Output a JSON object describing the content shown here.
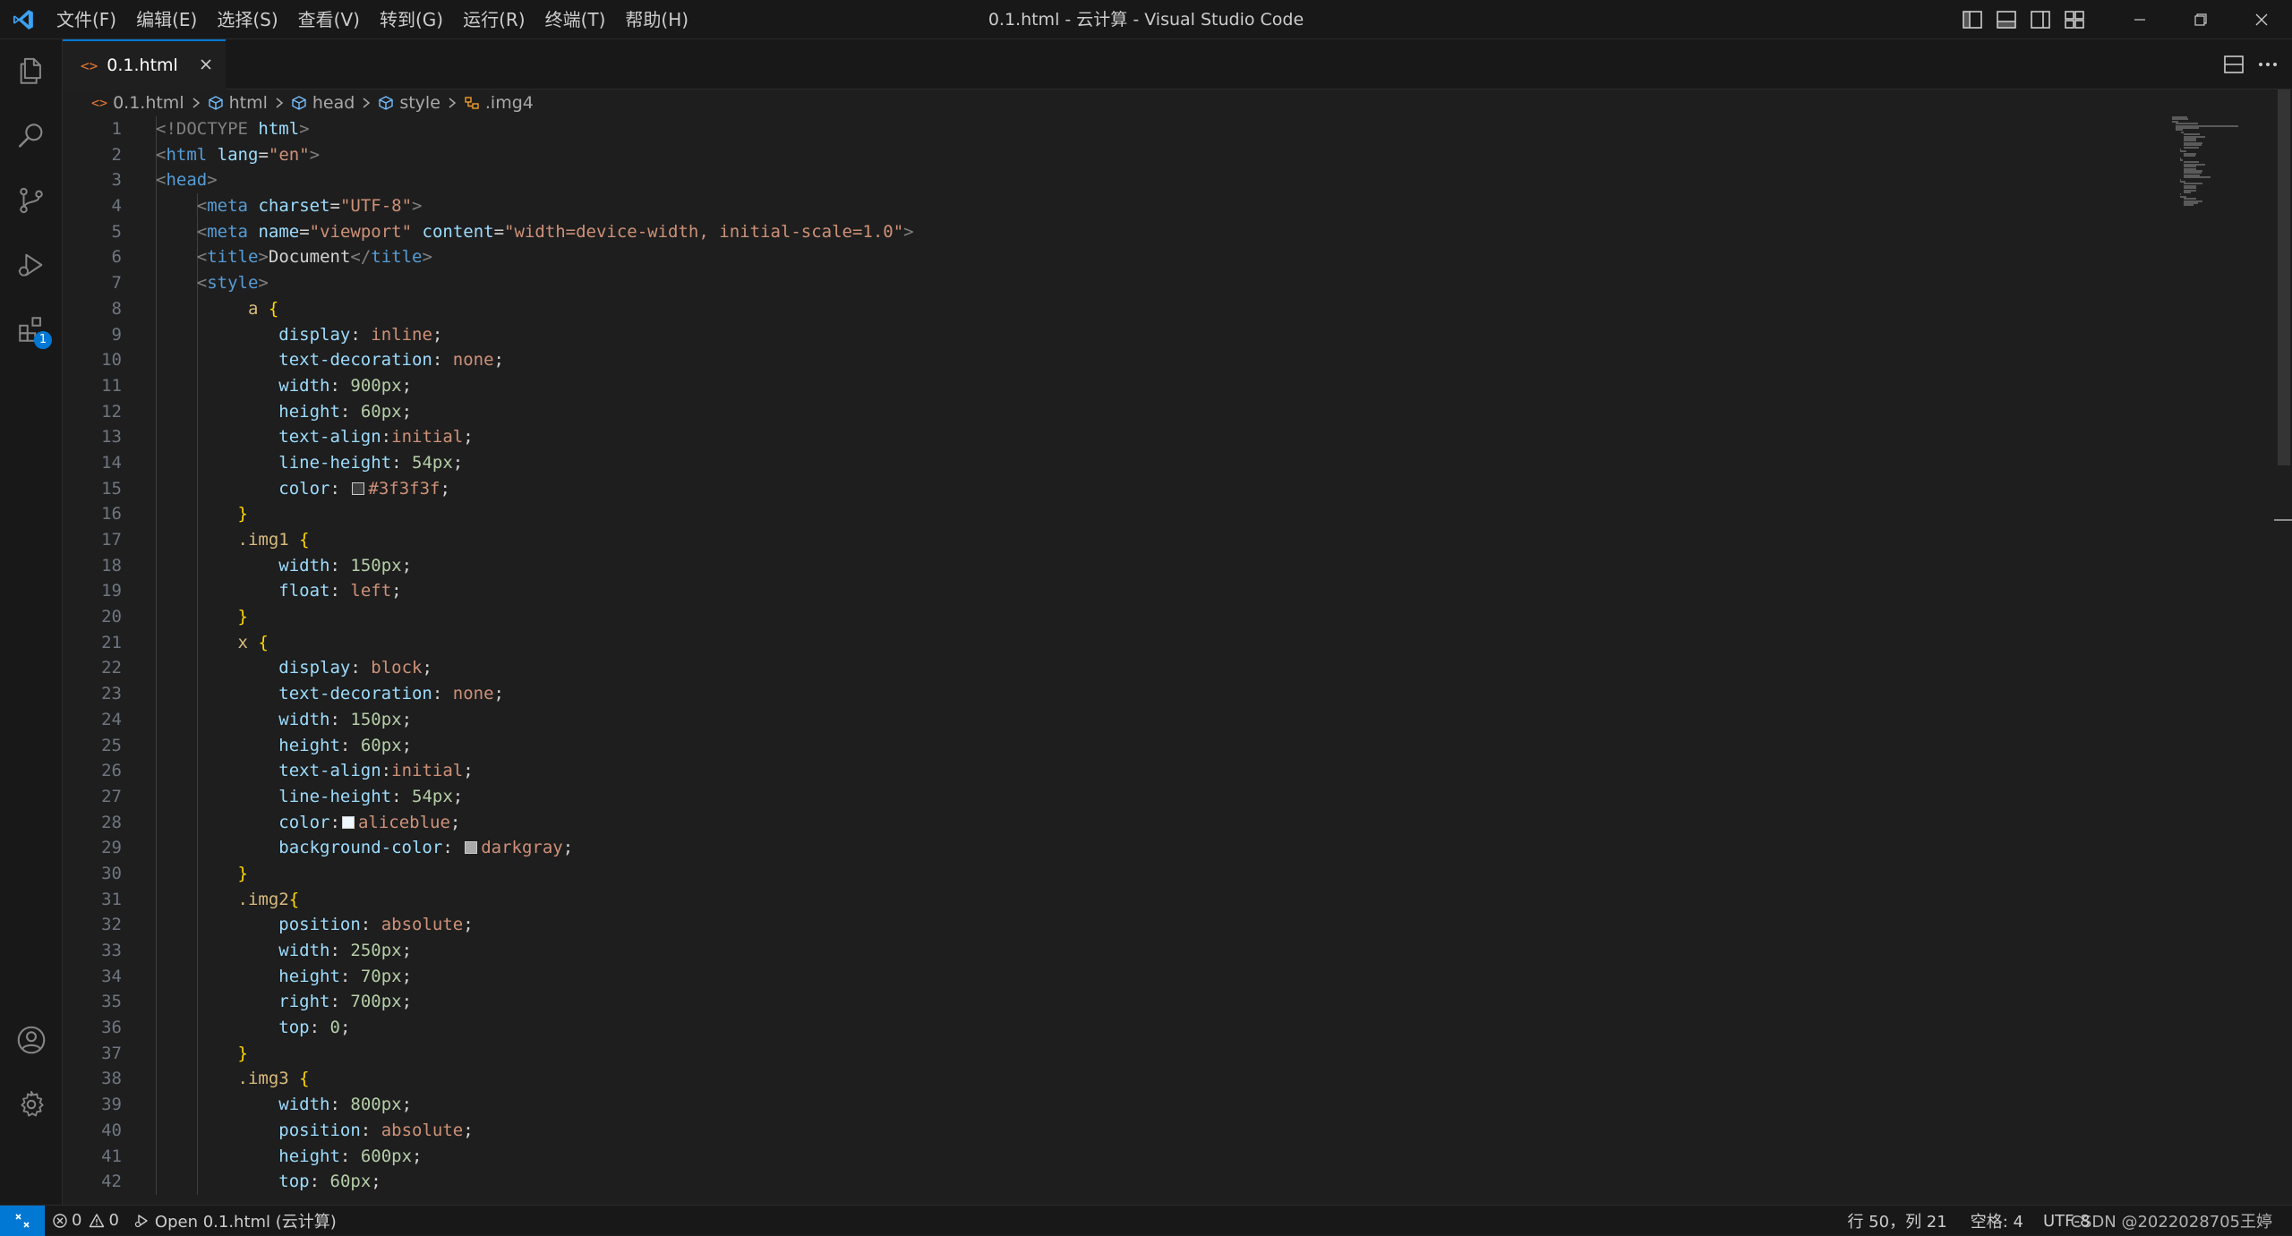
{
  "titlebar": {
    "menu": [
      "文件(F)",
      "编辑(E)",
      "选择(S)",
      "查看(V)",
      "转到(G)",
      "运行(R)",
      "终端(T)",
      "帮助(H)"
    ],
    "window_title": "0.1.html - 云计算 - Visual Studio Code"
  },
  "activitybar": {
    "extensions_badge": "1",
    "items": [
      "files-icon",
      "search-icon",
      "source-control-icon",
      "run-debug-icon",
      "extensions-icon",
      "account-icon",
      "gear-icon"
    ]
  },
  "tab": {
    "icon": "<>",
    "label": "0.1.html"
  },
  "breadcrumb": {
    "file": "0.1.html",
    "items": [
      "html",
      "head",
      "style",
      ".img4"
    ]
  },
  "editor": {
    "line_numbers": [
      "1",
      "2",
      "3",
      "4",
      "5",
      "6",
      "7",
      "8",
      "9",
      "10",
      "11",
      "12",
      "13",
      "14",
      "15",
      "16",
      "17",
      "18",
      "19",
      "20",
      "21",
      "22",
      "23",
      "24",
      "25",
      "26",
      "27",
      "28",
      "29",
      "30",
      "31",
      "32",
      "33",
      "34",
      "35",
      "36",
      "37",
      "38",
      "39",
      "40",
      "41",
      "42"
    ],
    "lines": [
      [
        [
          "<!DOCTYPE",
          "punc"
        ],
        [
          " ",
          "text"
        ],
        [
          "html",
          "attr-w"
        ],
        [
          ">",
          "punc"
        ]
      ],
      [
        [
          "<",
          "punc"
        ],
        [
          "html",
          "tag"
        ],
        [
          " ",
          "text"
        ],
        [
          "lang",
          "attr"
        ],
        [
          "=",
          "text"
        ],
        [
          "\"en\"",
          "str"
        ],
        [
          ">",
          "punc"
        ]
      ],
      [
        [
          "<",
          "punc"
        ],
        [
          "head",
          "tag"
        ],
        [
          ">",
          "punc"
        ]
      ],
      [
        [
          "    ",
          "text"
        ],
        [
          "<",
          "punc"
        ],
        [
          "meta",
          "tag"
        ],
        [
          " ",
          "text"
        ],
        [
          "charset",
          "attr"
        ],
        [
          "=",
          "text"
        ],
        [
          "\"UTF-8\"",
          "str"
        ],
        [
          ">",
          "punc"
        ]
      ],
      [
        [
          "    ",
          "text"
        ],
        [
          "<",
          "punc"
        ],
        [
          "meta",
          "tag"
        ],
        [
          " ",
          "text"
        ],
        [
          "name",
          "attr"
        ],
        [
          "=",
          "text"
        ],
        [
          "\"viewport\"",
          "str"
        ],
        [
          " ",
          "text"
        ],
        [
          "content",
          "attr"
        ],
        [
          "=",
          "text"
        ],
        [
          "\"width=device-width, initial-scale=1.0\"",
          "str"
        ],
        [
          ">",
          "punc"
        ]
      ],
      [
        [
          "    ",
          "text"
        ],
        [
          "<",
          "punc"
        ],
        [
          "title",
          "tag"
        ],
        [
          ">",
          "punc"
        ],
        [
          "Document",
          "text"
        ],
        [
          "</",
          "punc"
        ],
        [
          "title",
          "tag"
        ],
        [
          ">",
          "punc"
        ]
      ],
      [
        [
          "    ",
          "text"
        ],
        [
          "<",
          "punc"
        ],
        [
          "style",
          "tag"
        ],
        [
          ">",
          "punc"
        ]
      ],
      [
        [
          "         ",
          "text"
        ],
        [
          "a",
          "sel"
        ],
        [
          " ",
          "text"
        ],
        [
          "{",
          "brace"
        ]
      ],
      [
        [
          "            ",
          "text"
        ],
        [
          "display",
          "prop"
        ],
        [
          ": ",
          "text"
        ],
        [
          "inline",
          "val"
        ],
        [
          ";",
          "text"
        ]
      ],
      [
        [
          "            ",
          "text"
        ],
        [
          "text-decoration",
          "prop"
        ],
        [
          ": ",
          "text"
        ],
        [
          "none",
          "val"
        ],
        [
          ";",
          "text"
        ]
      ],
      [
        [
          "            ",
          "text"
        ],
        [
          "width",
          "prop"
        ],
        [
          ": ",
          "text"
        ],
        [
          "900px",
          "num"
        ],
        [
          ";",
          "text"
        ]
      ],
      [
        [
          "            ",
          "text"
        ],
        [
          "height",
          "prop"
        ],
        [
          ": ",
          "text"
        ],
        [
          "60px",
          "num"
        ],
        [
          ";",
          "text"
        ]
      ],
      [
        [
          "            ",
          "text"
        ],
        [
          "text-align",
          "prop"
        ],
        [
          ":",
          "text"
        ],
        [
          "initial",
          "val"
        ],
        [
          ";",
          "text"
        ]
      ],
      [
        [
          "            ",
          "text"
        ],
        [
          "line-height",
          "prop"
        ],
        [
          ": ",
          "text"
        ],
        [
          "54px",
          "num"
        ],
        [
          ";",
          "text"
        ]
      ],
      [
        [
          "            ",
          "text"
        ],
        [
          "color",
          "prop"
        ],
        [
          ": ",
          "text"
        ],
        [
          "#3f3f3f",
          "swatch"
        ],
        [
          "#3f3f3f",
          "val"
        ],
        [
          ";",
          "text"
        ]
      ],
      [
        [
          "        ",
          "text"
        ],
        [
          "}",
          "brace"
        ]
      ],
      [
        [
          "        ",
          "text"
        ],
        [
          ".img1",
          "sel"
        ],
        [
          " ",
          "text"
        ],
        [
          "{",
          "brace"
        ]
      ],
      [
        [
          "            ",
          "text"
        ],
        [
          "width",
          "prop"
        ],
        [
          ": ",
          "text"
        ],
        [
          "150px",
          "num"
        ],
        [
          ";",
          "text"
        ]
      ],
      [
        [
          "            ",
          "text"
        ],
        [
          "float",
          "prop"
        ],
        [
          ": ",
          "text"
        ],
        [
          "left",
          "val"
        ],
        [
          ";",
          "text"
        ]
      ],
      [
        [
          "        ",
          "text"
        ],
        [
          "}",
          "brace"
        ]
      ],
      [
        [
          "        ",
          "text"
        ],
        [
          "x",
          "sel"
        ],
        [
          " ",
          "text"
        ],
        [
          "{",
          "brace"
        ]
      ],
      [
        [
          "            ",
          "text"
        ],
        [
          "display",
          "prop"
        ],
        [
          ": ",
          "text"
        ],
        [
          "block",
          "val"
        ],
        [
          ";",
          "text"
        ]
      ],
      [
        [
          "            ",
          "text"
        ],
        [
          "text-decoration",
          "prop"
        ],
        [
          ": ",
          "text"
        ],
        [
          "none",
          "val"
        ],
        [
          ";",
          "text"
        ]
      ],
      [
        [
          "            ",
          "text"
        ],
        [
          "width",
          "prop"
        ],
        [
          ": ",
          "text"
        ],
        [
          "150px",
          "num"
        ],
        [
          ";",
          "text"
        ]
      ],
      [
        [
          "            ",
          "text"
        ],
        [
          "height",
          "prop"
        ],
        [
          ": ",
          "text"
        ],
        [
          "60px",
          "num"
        ],
        [
          ";",
          "text"
        ]
      ],
      [
        [
          "            ",
          "text"
        ],
        [
          "text-align",
          "prop"
        ],
        [
          ":",
          "text"
        ],
        [
          "initial",
          "val"
        ],
        [
          ";",
          "text"
        ]
      ],
      [
        [
          "            ",
          "text"
        ],
        [
          "line-height",
          "prop"
        ],
        [
          ": ",
          "text"
        ],
        [
          "54px",
          "num"
        ],
        [
          ";",
          "text"
        ]
      ],
      [
        [
          "            ",
          "text"
        ],
        [
          "color",
          "prop"
        ],
        [
          ":",
          "text"
        ],
        [
          "#f0f8ff",
          "swatch"
        ],
        [
          "aliceblue",
          "val"
        ],
        [
          ";",
          "text"
        ]
      ],
      [
        [
          "            ",
          "text"
        ],
        [
          "background-color",
          "prop"
        ],
        [
          ": ",
          "text"
        ],
        [
          "#a9a9a9",
          "swatch"
        ],
        [
          "darkgray",
          "val"
        ],
        [
          ";",
          "text"
        ]
      ],
      [
        [
          "        ",
          "text"
        ],
        [
          "}",
          "brace"
        ]
      ],
      [
        [
          "        ",
          "text"
        ],
        [
          ".img2",
          "sel"
        ],
        [
          "{",
          "brace"
        ]
      ],
      [
        [
          "            ",
          "text"
        ],
        [
          "position",
          "prop"
        ],
        [
          ": ",
          "text"
        ],
        [
          "absolute",
          "val"
        ],
        [
          ";",
          "text"
        ]
      ],
      [
        [
          "            ",
          "text"
        ],
        [
          "width",
          "prop"
        ],
        [
          ": ",
          "text"
        ],
        [
          "250px",
          "num"
        ],
        [
          ";",
          "text"
        ]
      ],
      [
        [
          "            ",
          "text"
        ],
        [
          "height",
          "prop"
        ],
        [
          ": ",
          "text"
        ],
        [
          "70px",
          "num"
        ],
        [
          ";",
          "text"
        ]
      ],
      [
        [
          "            ",
          "text"
        ],
        [
          "right",
          "prop"
        ],
        [
          ": ",
          "text"
        ],
        [
          "700px",
          "num"
        ],
        [
          ";",
          "text"
        ]
      ],
      [
        [
          "            ",
          "text"
        ],
        [
          "top",
          "prop"
        ],
        [
          ": ",
          "text"
        ],
        [
          "0",
          "num"
        ],
        [
          ";",
          "text"
        ]
      ],
      [
        [
          "        ",
          "text"
        ],
        [
          "}",
          "brace"
        ]
      ],
      [
        [
          "        ",
          "text"
        ],
        [
          ".img3",
          "sel"
        ],
        [
          " ",
          "text"
        ],
        [
          "{",
          "brace"
        ]
      ],
      [
        [
          "            ",
          "text"
        ],
        [
          "width",
          "prop"
        ],
        [
          ": ",
          "text"
        ],
        [
          "800px",
          "num"
        ],
        [
          ";",
          "text"
        ]
      ],
      [
        [
          "            ",
          "text"
        ],
        [
          "position",
          "prop"
        ],
        [
          ": ",
          "text"
        ],
        [
          "absolute",
          "val"
        ],
        [
          ";",
          "text"
        ]
      ],
      [
        [
          "            ",
          "text"
        ],
        [
          "height",
          "prop"
        ],
        [
          ": ",
          "text"
        ],
        [
          "600px",
          "num"
        ],
        [
          ";",
          "text"
        ]
      ],
      [
        [
          "            ",
          "text"
        ],
        [
          "top",
          "prop"
        ],
        [
          ": ",
          "text"
        ],
        [
          "60px",
          "num"
        ],
        [
          ";",
          "text"
        ]
      ]
    ]
  },
  "statusbar": {
    "errors": "0",
    "warnings": "0",
    "open_label": "Open 0.1.html (云计算)",
    "cursor": "行 50，列 21",
    "spaces": "空格: 4",
    "encoding": "UTF-8",
    "watermark": "CSDN @2022028705王婷"
  },
  "colors": {
    "accent": "#0078d4",
    "background": "#1e1e1e",
    "chrome": "#181818"
  }
}
